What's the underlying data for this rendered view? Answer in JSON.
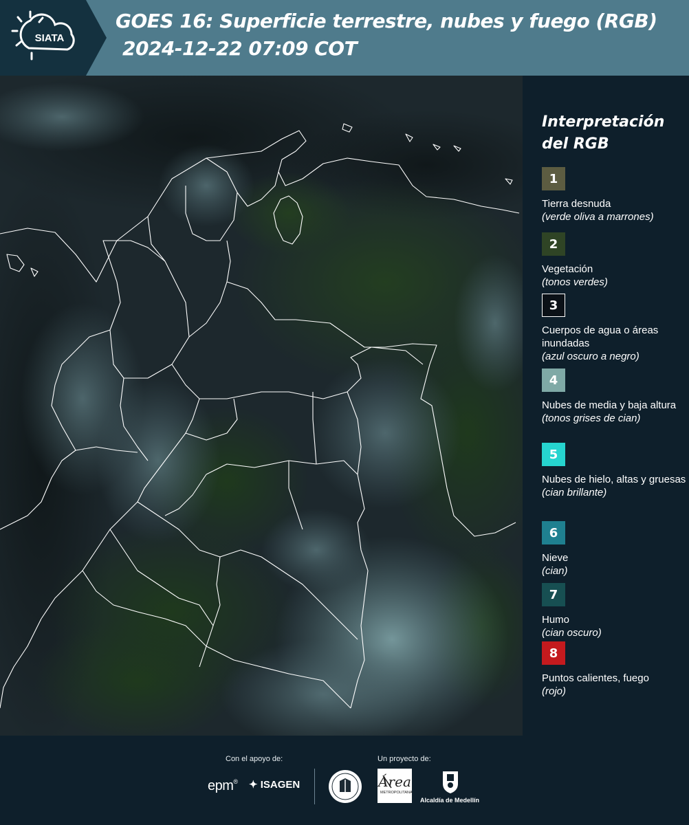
{
  "header": {
    "logo_text": "SIATA",
    "title_line_1": "GOES 16: Superficie terrestre, nubes y fuego (RGB)",
    "title_line_2": "2024-12-22 07:09 COT"
  },
  "legend": {
    "title": "Interpretación del RGB",
    "items": [
      {
        "number": "1",
        "label": "Tierra desnuda",
        "sub": "(verde oliva a marrones)",
        "color": "#5c5c41"
      },
      {
        "number": "2",
        "label": "Vegetación",
        "sub": "(tonos verdes)",
        "color": "#2f4425"
      },
      {
        "number": "3",
        "label": "Cuerpos de agua o áreas inundadas",
        "sub": "(azul oscuro a negro)",
        "color": "#0b1117"
      },
      {
        "number": "4",
        "label": "Nubes de media y baja altura",
        "sub": "(tonos grises de cian)",
        "color": "#7fa9a6"
      },
      {
        "number": "5",
        "label": "Nubes de hielo, altas y gruesas",
        "sub": "(cian brillante)",
        "color": "#26d4cf"
      },
      {
        "number": "6",
        "label": "Nieve",
        "sub": "(cian)",
        "color": "#1f8090"
      },
      {
        "number": "7",
        "label": "Humo",
        "sub": "(cian oscuro)",
        "color": "#174f52"
      },
      {
        "number": "8",
        "label": "Puntos calientes, fuego",
        "sub": "(rojo)",
        "color": "#c41a1e"
      }
    ]
  },
  "footer": {
    "support_caption": "Con el apoyo de:",
    "project_caption": "Un proyecto de:",
    "epm_logo": "epm",
    "isagen_logo": "ISAGEN",
    "amva_logo": "METROPOLITANA",
    "medellin_logo": "Alcaldía de Medellín"
  },
  "colors": {
    "header_bg": "#4f7b8c",
    "page_bg": "#0e1f2b",
    "boundary_lines": "#ffffff"
  }
}
